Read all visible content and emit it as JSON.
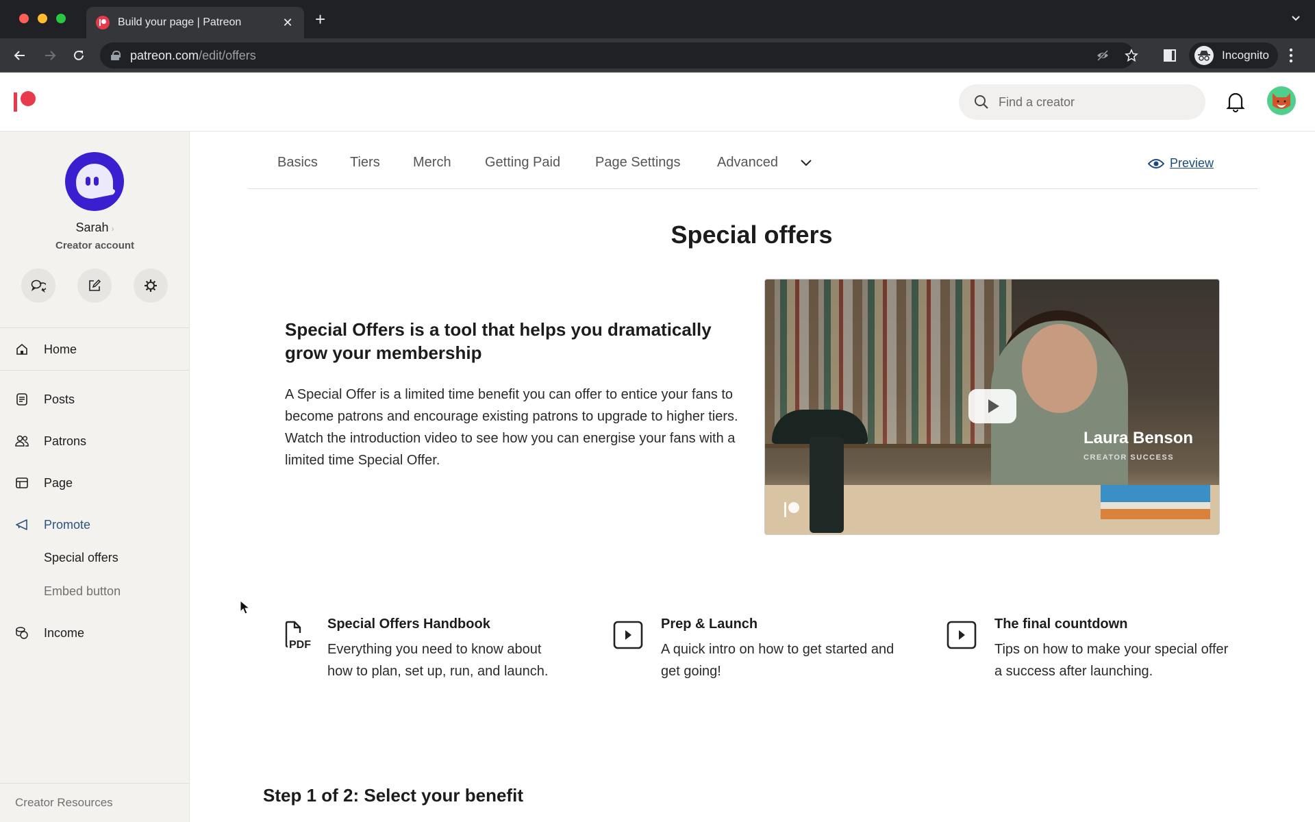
{
  "browser": {
    "tab_title": "Build your page | Patreon",
    "url_host": "patreon.com",
    "url_path": "/edit/offers",
    "profile_label": "Incognito"
  },
  "header": {
    "search_placeholder": "Find a creator"
  },
  "sidebar": {
    "creator_name": "Sarah",
    "creator_role": "Creator account",
    "quick_actions": [
      {
        "icon": "chat-bubbles-icon"
      },
      {
        "icon": "edit-icon"
      },
      {
        "icon": "settings-gear-icon"
      }
    ],
    "items": [
      {
        "label": "Home",
        "icon": "home-icon"
      },
      {
        "label": "Posts",
        "icon": "posts-icon"
      },
      {
        "label": "Patrons",
        "icon": "patrons-icon"
      },
      {
        "label": "Page",
        "icon": "page-layout-icon"
      },
      {
        "label": "Promote",
        "icon": "megaphone-icon",
        "active": true
      },
      {
        "label": "Income",
        "icon": "coins-icon"
      }
    ],
    "promote_subitems": [
      {
        "label": "Special offers",
        "current": true
      },
      {
        "label": "Embed button",
        "current": false
      }
    ],
    "footer_link": "Creator Resources"
  },
  "main": {
    "tabs": [
      {
        "label": "Basics"
      },
      {
        "label": "Tiers"
      },
      {
        "label": "Merch"
      },
      {
        "label": "Getting Paid"
      },
      {
        "label": "Page Settings"
      },
      {
        "label": "Advanced"
      }
    ],
    "preview_label": "Preview",
    "page_title": "Special offers",
    "intro_heading": "Special Offers is a tool that helps you dramatically grow your membership",
    "intro_body": "A Special Offer is a limited time benefit you can offer to entice your fans to become patrons and encourage existing patrons to upgrade to higher tiers. Watch the introduction video to see how you can energise your fans with a limited time Special Offer.",
    "video": {
      "presenter_name": "Laura Benson",
      "presenter_role": "CREATOR SUCCESS"
    },
    "resources": [
      {
        "icon": "pdf-file-icon",
        "title": "Special Offers Handbook",
        "description": "Everything you need to know about how to plan, set up, run, and launch."
      },
      {
        "icon": "video-play-icon",
        "title": "Prep & Launch",
        "description": "A quick intro on how to get started and get going!"
      },
      {
        "icon": "video-play-icon",
        "title": "The final countdown",
        "description": "Tips on how to make your special offer a success after launching."
      }
    ],
    "step_title": "Step 1 of 2: Select your benefit"
  },
  "colors": {
    "brand": "#e8394d",
    "active_nav": "#2a5480",
    "link": "#1e4a7a",
    "sidebar_bg": "#f3f2ef"
  }
}
